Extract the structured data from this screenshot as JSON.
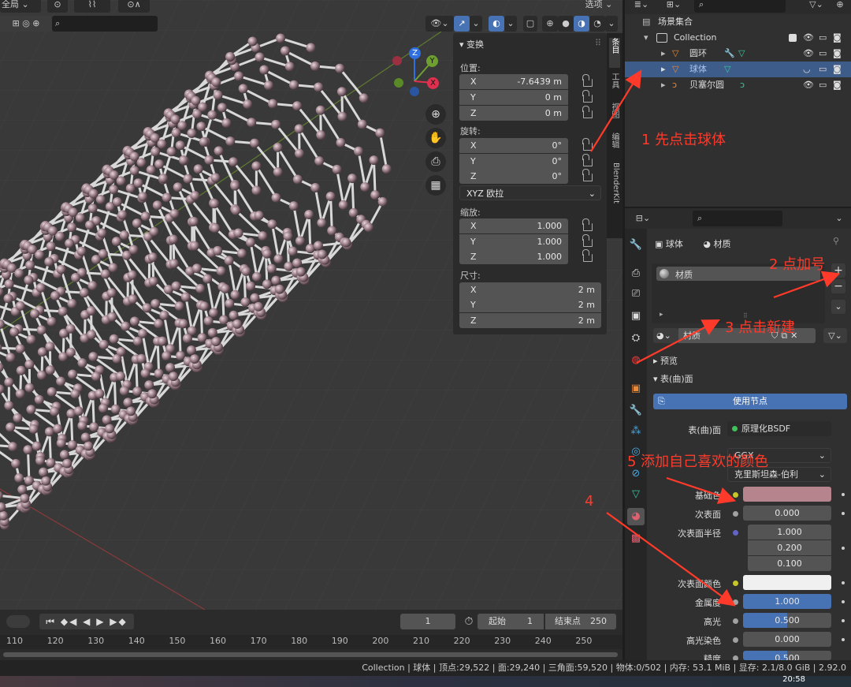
{
  "header": {
    "global_label": "全局",
    "options_label": "选项"
  },
  "npanel": {
    "title": "变换",
    "location": {
      "label": "位置:",
      "x": "-7.6439 m",
      "y": "0 m",
      "z": "0 m"
    },
    "rotation": {
      "label": "旋转:",
      "x": "0°",
      "y": "0°",
      "z": "0°",
      "mode": "XYZ 欧拉"
    },
    "scale": {
      "label": "缩放:",
      "x": "1.000",
      "y": "1.000",
      "z": "1.000"
    },
    "dimensions": {
      "label": "尺寸:",
      "x": "2 m",
      "y": "2 m",
      "z": "2 m"
    },
    "axes": {
      "x": "X",
      "y": "Y",
      "z": "Z"
    },
    "tabs": [
      "条目",
      "工具",
      "视图",
      "编辑",
      "BlenderKit"
    ]
  },
  "gizmo": {
    "x": "X",
    "y": "Y",
    "z": "Z"
  },
  "timeline": {
    "current_frame": "1",
    "start_label": "起始",
    "start": "1",
    "end_label": "结束点",
    "end": "250",
    "ticks": [
      "110",
      "120",
      "130",
      "140",
      "150",
      "160",
      "170",
      "180",
      "190",
      "200",
      "210",
      "220",
      "230",
      "240",
      "250"
    ]
  },
  "outliner": {
    "root": "场景集合",
    "collection": "Collection",
    "items": [
      {
        "name": "圆环"
      },
      {
        "name": "球体"
      },
      {
        "name": "贝塞尔圆"
      }
    ]
  },
  "properties": {
    "breadcrumb_object": "球体",
    "breadcrumb_material": "材质",
    "slot_name": "材质",
    "material_name": "材质",
    "preview_label": "预览",
    "surface_label": "表(曲)面",
    "use_nodes_label": "使用节点",
    "surface_field_label": "表(曲)面",
    "surface_shader": "原理化BSDF",
    "distribution": "GGX",
    "subsurface_method": "克里斯坦森-伯利",
    "base_color_label": "基础色",
    "subsurface_label": "次表面",
    "subsurface_value": "0.000",
    "subsurface_radius_label": "次表面半径",
    "subsurface_radius": [
      "1.000",
      "0.200",
      "0.100"
    ],
    "subsurface_color_label": "次表面颜色",
    "metallic_label": "金属度",
    "metallic_value": "1.000",
    "specular_label": "高光",
    "specular_value": "0.500",
    "specular_tint_label": "高光染色",
    "specular_tint_value": "0.000",
    "roughness_label": "糙度",
    "roughness_value": "0.500",
    "base_color_hex": "#b5848c"
  },
  "statusbar": {
    "text": "Collection | 球体 | 顶点:29,522 | 面:29,240 | 三角面:59,520 | 物体:0/502 | 内存: 53.1 MiB | 显存: 2.1/8.0 GiB | 2.92.0"
  },
  "taskbar": {
    "time": "20:58"
  },
  "annotations": {
    "a1": "1 先点击球体",
    "a2": "2 点加号",
    "a3": "3 点击新建",
    "a4": "4",
    "a5": "5 添加自己喜欢的颜色"
  },
  "colors": {
    "accent": "#4772b3",
    "annotation": "#ff3a2a",
    "selected_row": "#3d5c8a"
  }
}
